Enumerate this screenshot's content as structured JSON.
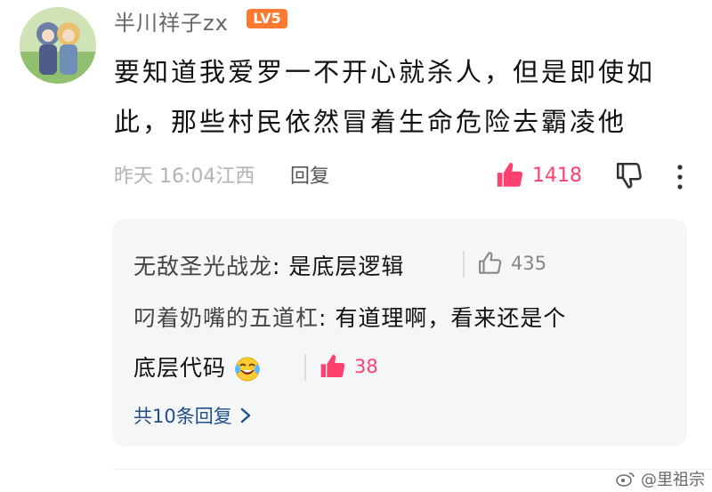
{
  "comment": {
    "username": "半川祥子zx",
    "level_badge": "LV5",
    "text": "要知道我爱罗一不开心就杀人，但是即使如此，那些村民依然冒着生命危险去霸凌他",
    "time_location": "昨天 16:04江西",
    "reply_label": "回复",
    "likes": "1418",
    "colors": {
      "like": "#ff3f6e",
      "badge": "#ff7a2f",
      "link": "#1f4f8a"
    }
  },
  "replies": [
    {
      "name": "无敌圣光战龙",
      "sep": ": ",
      "text": "是底层逻辑",
      "likes": "435",
      "liked": false
    },
    {
      "name": "叼着奶嘴的五道杠",
      "sep": ": ",
      "text_line1": "有道理啊，看来还是个",
      "text_line2": "底层代码",
      "emoji": "laughing-crying-emoji",
      "likes": "38",
      "liked": true
    }
  ],
  "more_replies": "共10条回复",
  "watermark": "@里祖宗"
}
